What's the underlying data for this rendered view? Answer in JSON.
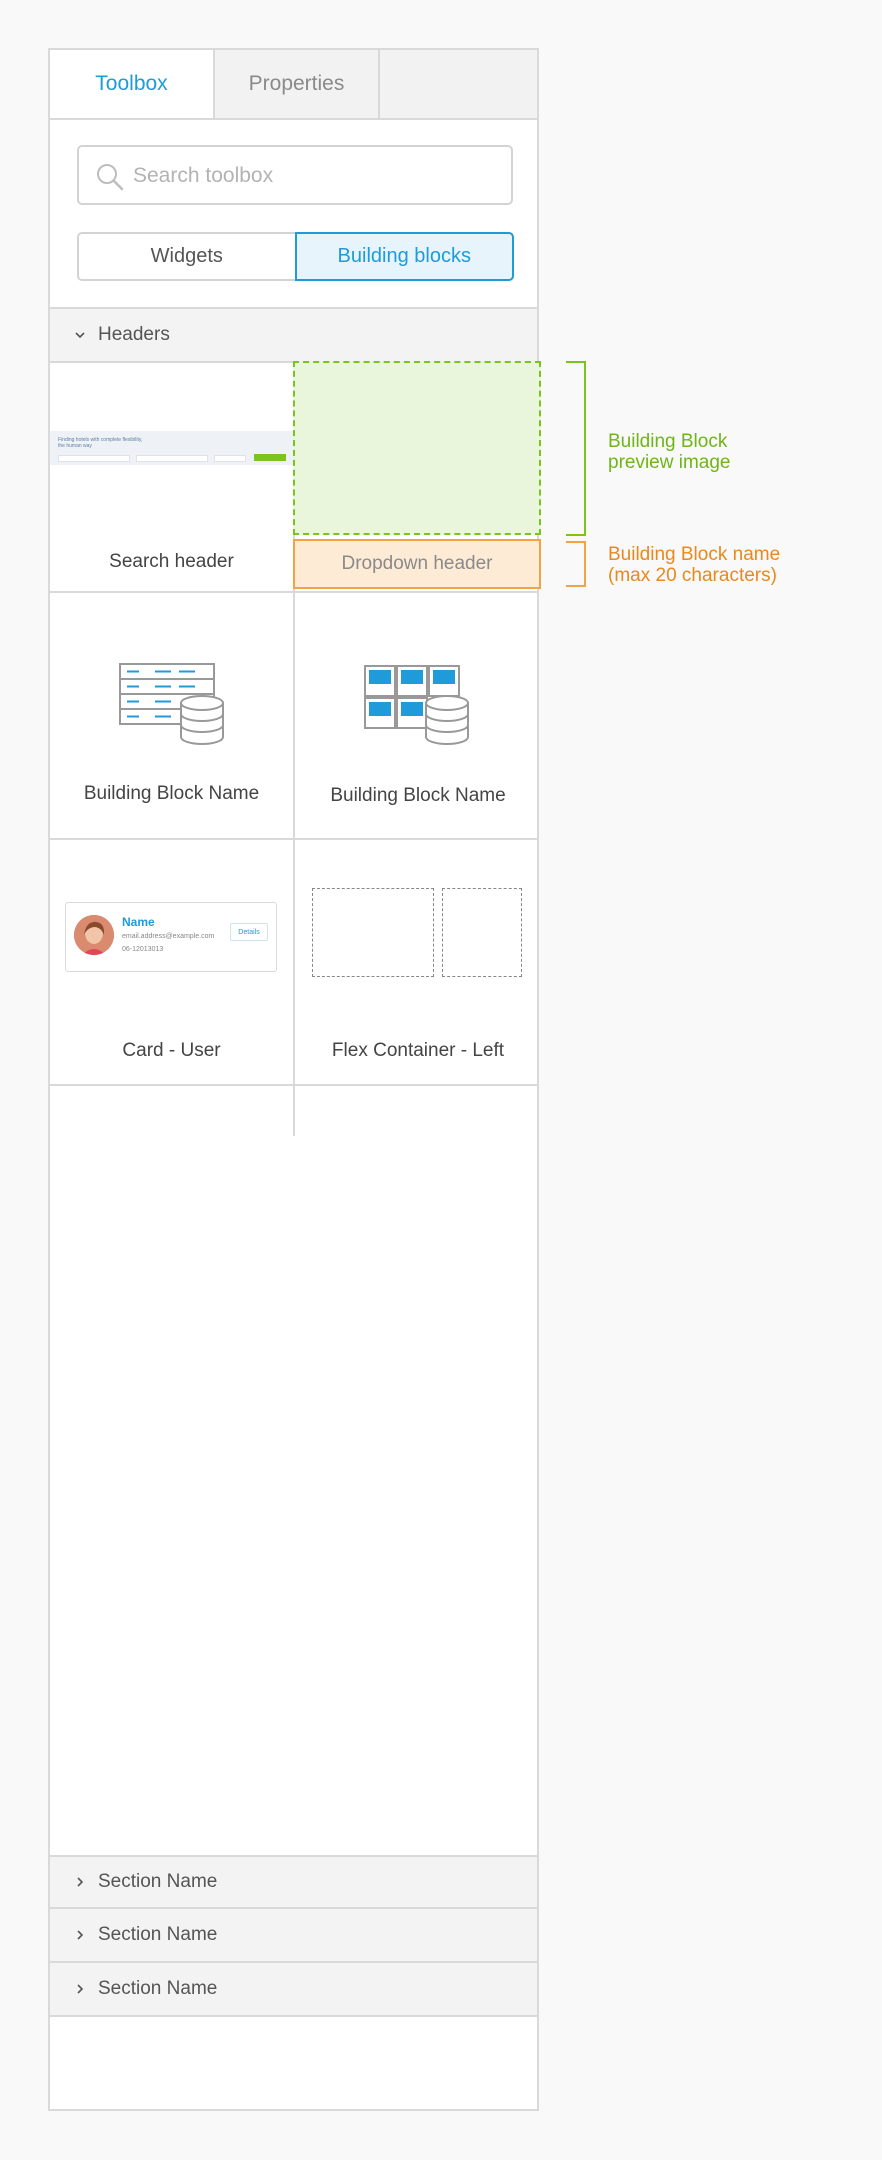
{
  "tabs": {
    "toolbox": "Toolbox",
    "properties": "Properties"
  },
  "search": {
    "placeholder": "Search toolbox"
  },
  "toggle": {
    "widgets": "Widgets",
    "building_blocks": "Building blocks"
  },
  "headers_section": {
    "title": "Headers"
  },
  "blocks": [
    {
      "name": "Search header"
    },
    {
      "name": "Dropdown header"
    },
    {
      "name": "Building Block Name"
    },
    {
      "name": "Building Block Name"
    },
    {
      "name": "Card - User"
    },
    {
      "name": "Flex Container - Left"
    }
  ],
  "thumbnail": {
    "headline_line1": "Finding hotels with complete flexibility,",
    "headline_line2": "the human way"
  },
  "user_card": {
    "name": "Name",
    "email": "email.address@example.com",
    "phone": "06-12013013",
    "details_label": "Details"
  },
  "collapsed_sections": [
    {
      "title": "Section Name"
    },
    {
      "title": "Section Name"
    },
    {
      "title": "Section Name"
    }
  ],
  "annotations": {
    "preview_line1": "Building Block",
    "preview_line2": "preview image",
    "name_line1": "Building Block name",
    "name_line2": "(max 20 characters)"
  },
  "colors": {
    "accent_blue": "#1e9bd8",
    "annotation_green": "#7ac41c",
    "annotation_orange": "#f0a445",
    "border_gray": "#d9d9d9"
  }
}
